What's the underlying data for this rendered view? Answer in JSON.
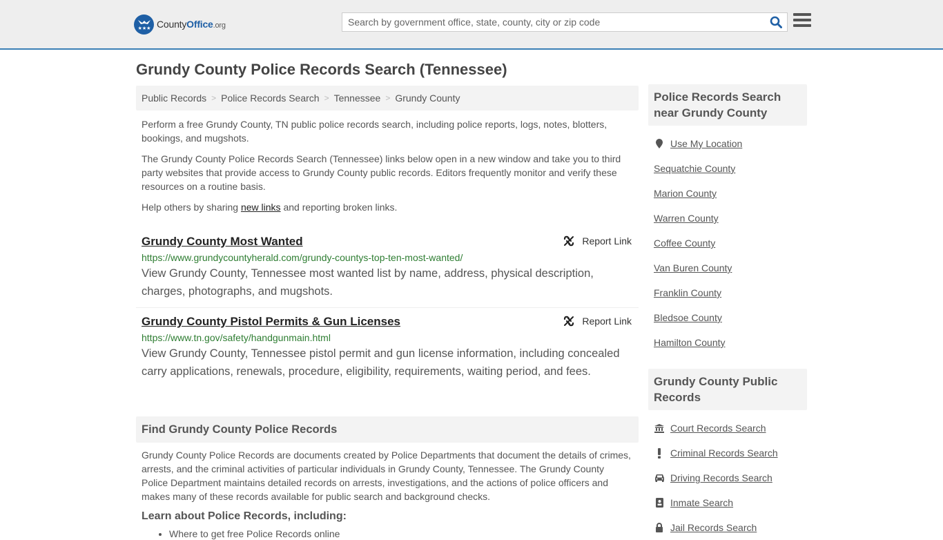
{
  "header": {
    "logo": {
      "name": "County",
      "highlight": "Office",
      "suffix": ".org"
    },
    "search": {
      "placeholder": "Search by government office, state, county, city or zip code",
      "value": ""
    }
  },
  "page": {
    "title": "Grundy County Police Records Search (Tennessee)"
  },
  "breadcrumb": [
    "Public Records",
    "Police Records Search",
    "Tennessee",
    "Grundy County"
  ],
  "intro": {
    "p1": "Perform a free Grundy County, TN public police records search, including police reports, logs, notes, blotters, bookings, and mugshots.",
    "p2": "The Grundy County Police Records Search (Tennessee) links below open in a new window and take you to third party websites that provide access to Grundy County public records. Editors frequently monitor and verify these resources on a routine basis.",
    "p3_before": "Help others by sharing ",
    "p3_link": "new links",
    "p3_after": " and reporting broken links."
  },
  "links": [
    {
      "title": "Grundy County Most Wanted",
      "url": "https://www.grundycountyherald.com/grundy-countys-top-ten-most-wanted/",
      "description": "View Grundy County, Tennessee most wanted list by name, address, physical description, charges, photographs, and mugshots.",
      "report_label": "Report Link"
    },
    {
      "title": "Grundy County Pistol Permits & Gun Licenses",
      "url": "https://www.tn.gov/safety/handgunmain.html",
      "description": "View Grundy County, Tennessee pistol permit and gun license information, including concealed carry applications, renewals, procedure, eligibility, requirements, waiting period, and fees.",
      "report_label": "Report Link"
    }
  ],
  "find_section": {
    "heading": "Find Grundy County Police Records",
    "body": "Grundy County Police Records are documents created by Police Departments that document the details of crimes, arrests, and the criminal activities of particular individuals in Grundy County, Tennessee. The Grundy County Police Department maintains detailed records on arrests, investigations, and the actions of police officers and makes many of these records available for public search and background checks.",
    "learn_heading": "Learn about Police Records, including:",
    "learn_items": [
      "Where to get free Police Records online"
    ]
  },
  "sidebar": {
    "nearby": {
      "heading": "Police Records Search near Grundy County",
      "use_location": "Use My Location",
      "counties": [
        "Sequatchie County",
        "Marion County",
        "Warren County",
        "Coffee County",
        "Van Buren County",
        "Franklin County",
        "Bledsoe County",
        "Hamilton County"
      ]
    },
    "public_records": {
      "heading": "Grundy County Public Records",
      "items": [
        {
          "label": "Court Records Search",
          "icon": "courthouse-icon"
        },
        {
          "label": "Criminal Records Search",
          "icon": "exclamation-icon"
        },
        {
          "label": "Driving Records Search",
          "icon": "car-icon"
        },
        {
          "label": "Inmate Search",
          "icon": "id-badge-icon"
        },
        {
          "label": "Jail Records Search",
          "icon": "lock-icon"
        }
      ]
    }
  },
  "colors": {
    "brand": "#1e5fa5",
    "header_border": "#3a7fb5",
    "url_green": "#2e7d32"
  }
}
